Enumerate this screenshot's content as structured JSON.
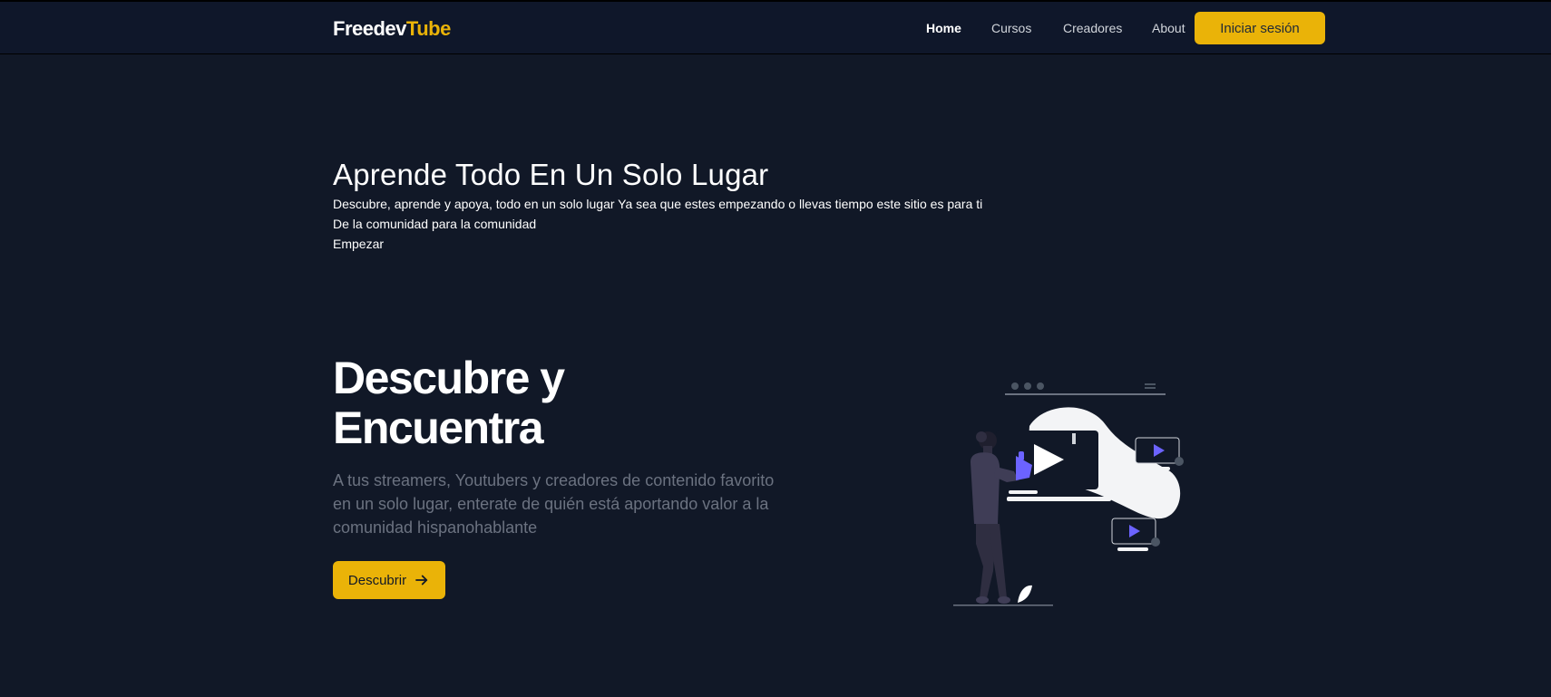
{
  "navbar": {
    "logo_part1": "Freedev",
    "logo_part2": "Tube",
    "links": [
      {
        "label": "Home",
        "active": true
      },
      {
        "label": "Cursos",
        "active": false
      },
      {
        "label": "Creadores",
        "active": false
      },
      {
        "label": "About",
        "active": false
      }
    ],
    "login_label": "Iniciar sesión"
  },
  "hero": {
    "title": "Aprende Todo En Un Solo Lugar",
    "line1": "Descubre, aprende y apoya, todo en un solo lugar Ya sea que estes empezando o llevas tiempo este sitio es para ti",
    "line2": "De la comunidad para la comunidad",
    "cta": "Empezar"
  },
  "discover": {
    "title": "Descubre y Encuentra",
    "description": "A tus streamers, Youtubers y creadores de contenido favorito en un solo lugar, enterate de quién está aportando valor a la comunidad hispanohablante",
    "button_label": "Descubrir",
    "button_icon": "arrow-right-icon"
  },
  "colors": {
    "background": "#111827",
    "navbar": "#0f172a",
    "accent": "#eab308",
    "muted_text": "#6b7280",
    "illustration_accent": "#6c63ff"
  }
}
